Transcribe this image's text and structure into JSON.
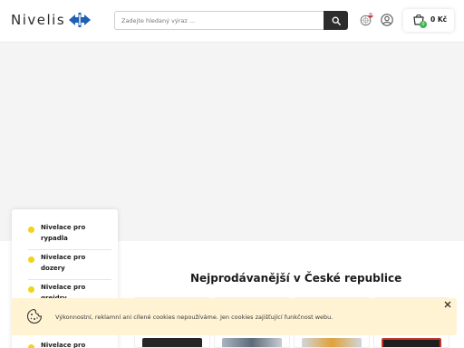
{
  "header": {
    "logo_text": "Nivelis",
    "search": {
      "placeholder": "Zadejte hledaný výraz ..."
    },
    "icons": {
      "search": "search-icon",
      "language": "flag-icon",
      "account": "user-icon",
      "cart": "cart-icon"
    },
    "cart": {
      "count": "0",
      "total": "0 Kč"
    }
  },
  "categories": [
    {
      "label": "Nivelace pro rypadla"
    },
    {
      "label": "Nivelace pro dozery"
    },
    {
      "label": "Nivelace pro grejdry"
    },
    {
      "label": "Nivelace pro"
    }
  ],
  "main": {
    "section_title": "Nejprodávanější v České republice"
  },
  "cookie_bar": {
    "text": "Výkonnostní, reklamní ani cílené cookies nepoužíváme. Jen cookies zajišťující funkčnost webu.",
    "close_label": "✕"
  },
  "colors": {
    "accent_yellow": "#f0d31a",
    "brand_blue": "#1f5fb4",
    "cart_badge": "#3bb54a",
    "cookie_bg": "#fff3d3",
    "dark_button": "#2c2c2c"
  }
}
